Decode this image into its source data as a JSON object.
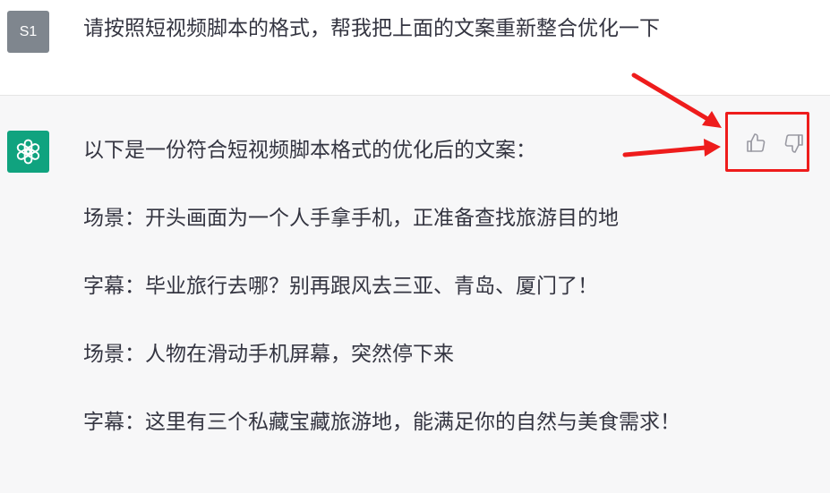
{
  "user": {
    "avatar_text": "S1",
    "message": "请按照短视频脚本的格式，帮我把上面的文案重新整合优化一下"
  },
  "assistant": {
    "avatar_icon": "openai-logo-icon",
    "paragraphs": [
      "以下是一份符合短视频脚本格式的优化后的文案：",
      "场景：开头画面为一个人手拿手机，正准备查找旅游目的地",
      "字幕：毕业旅行去哪？别再跟风去三亚、青岛、厦门了！",
      "场景：人物在滑动手机屏幕，突然停下来",
      "字幕：这里有三个私藏宝藏旅游地，能满足你的自然与美食需求！"
    ]
  },
  "feedback": {
    "thumbs_up_icon": "thumbs-up-icon",
    "thumbs_down_icon": "thumbs-down-icon",
    "highlight_color": "#ee1c1c"
  },
  "colors": {
    "assistant_bg": "#f7f7f8",
    "gpt_green": "#10a37f",
    "user_avatar_bg": "#7f868e",
    "text": "#343541",
    "annotation_red": "#ee1c1c"
  }
}
